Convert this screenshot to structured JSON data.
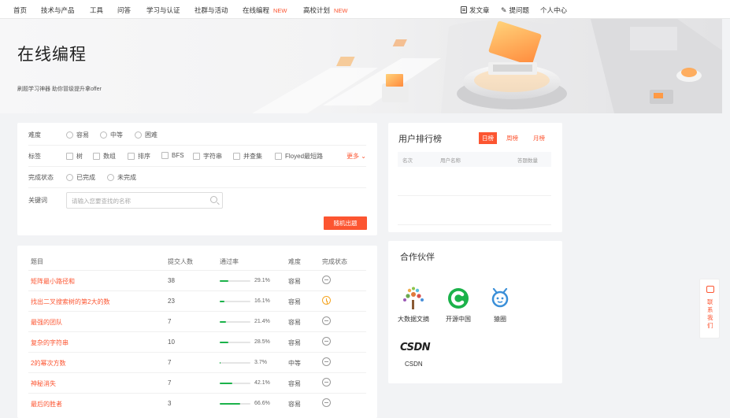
{
  "nav": {
    "items": [
      {
        "label": "首页"
      },
      {
        "label": "技术与产品"
      },
      {
        "label": "工具"
      },
      {
        "label": "问答"
      },
      {
        "label": "学习与认证"
      },
      {
        "label": "社群与活动"
      },
      {
        "label": "在线编程",
        "badge": "NEW"
      },
      {
        "label": "高校计划",
        "badge": "NEW"
      }
    ],
    "right": {
      "write": "发文章",
      "ask": "提问题",
      "profile": "个人中心"
    }
  },
  "banner": {
    "title": "在线编程",
    "subtitle": "刷题学习神器 助你冒级提升拿offer"
  },
  "filters": {
    "difficulty_label": "难度",
    "difficulty_options": [
      "容易",
      "中等",
      "困难"
    ],
    "tag_label": "标签",
    "tags": [
      "树",
      "数组",
      "排序",
      "BFS",
      "字符串",
      "并查集",
      "Floyed最短路"
    ],
    "more": "更多",
    "status_label": "完成状态",
    "status_options": [
      "已完成",
      "未完成"
    ],
    "keyword_label": "关键词",
    "keyword_placeholder": "请输入您要查找的名称",
    "random_button": "随机出题"
  },
  "ranking": {
    "title": "用户排行榜",
    "tabs": [
      "日榜",
      "周榜",
      "月榜"
    ],
    "active_tab": "日榜",
    "columns": [
      "名次",
      "用户名称",
      "答题数量"
    ]
  },
  "problems": {
    "columns": [
      "题目",
      "提交人数",
      "通过率",
      "难度",
      "完成状态"
    ],
    "rows": [
      {
        "title": "矩阵最小路径和",
        "submissions": "38",
        "pass_rate": "29.1%",
        "pass_value": 0.291,
        "difficulty": "容易",
        "status": "not-done"
      },
      {
        "title": "找出二叉搜索树的第2大的数",
        "submissions": "23",
        "pass_rate": "16.1%",
        "pass_value": 0.161,
        "difficulty": "容易",
        "status": "in-progress"
      },
      {
        "title": "最强的团队",
        "submissions": "7",
        "pass_rate": "21.4%",
        "pass_value": 0.214,
        "difficulty": "容易",
        "status": "not-done"
      },
      {
        "title": "复杂的字符串",
        "submissions": "10",
        "pass_rate": "28.5%",
        "pass_value": 0.285,
        "difficulty": "容易",
        "status": "not-done"
      },
      {
        "title": "2的幂次方数",
        "submissions": "7",
        "pass_rate": "3.7%",
        "pass_value": 0.037,
        "difficulty": "中等",
        "status": "not-done"
      },
      {
        "title": "神秘消失",
        "submissions": "7",
        "pass_rate": "42.1%",
        "pass_value": 0.421,
        "difficulty": "容易",
        "status": "not-done"
      },
      {
        "title": "最后的胜者",
        "submissions": "3",
        "pass_rate": "66.6%",
        "pass_value": 0.666,
        "difficulty": "容易",
        "status": "not-done"
      }
    ]
  },
  "partners": {
    "title": "合作伙伴",
    "items": [
      {
        "name": "大数据文摘",
        "icon": "tree-logo-icon"
      },
      {
        "name": "开源中国",
        "icon": "oschina-logo-icon"
      },
      {
        "name": "猿圈",
        "icon": "yuanquan-logo-icon"
      },
      {
        "name": "CSDN",
        "icon": "csdn-logo-icon",
        "logo_text": "CSDN"
      }
    ]
  },
  "contact": {
    "label": "联系我们"
  },
  "colors": {
    "accent": "#fc5531",
    "success": "#1bb24a",
    "warning": "#f5a623"
  }
}
